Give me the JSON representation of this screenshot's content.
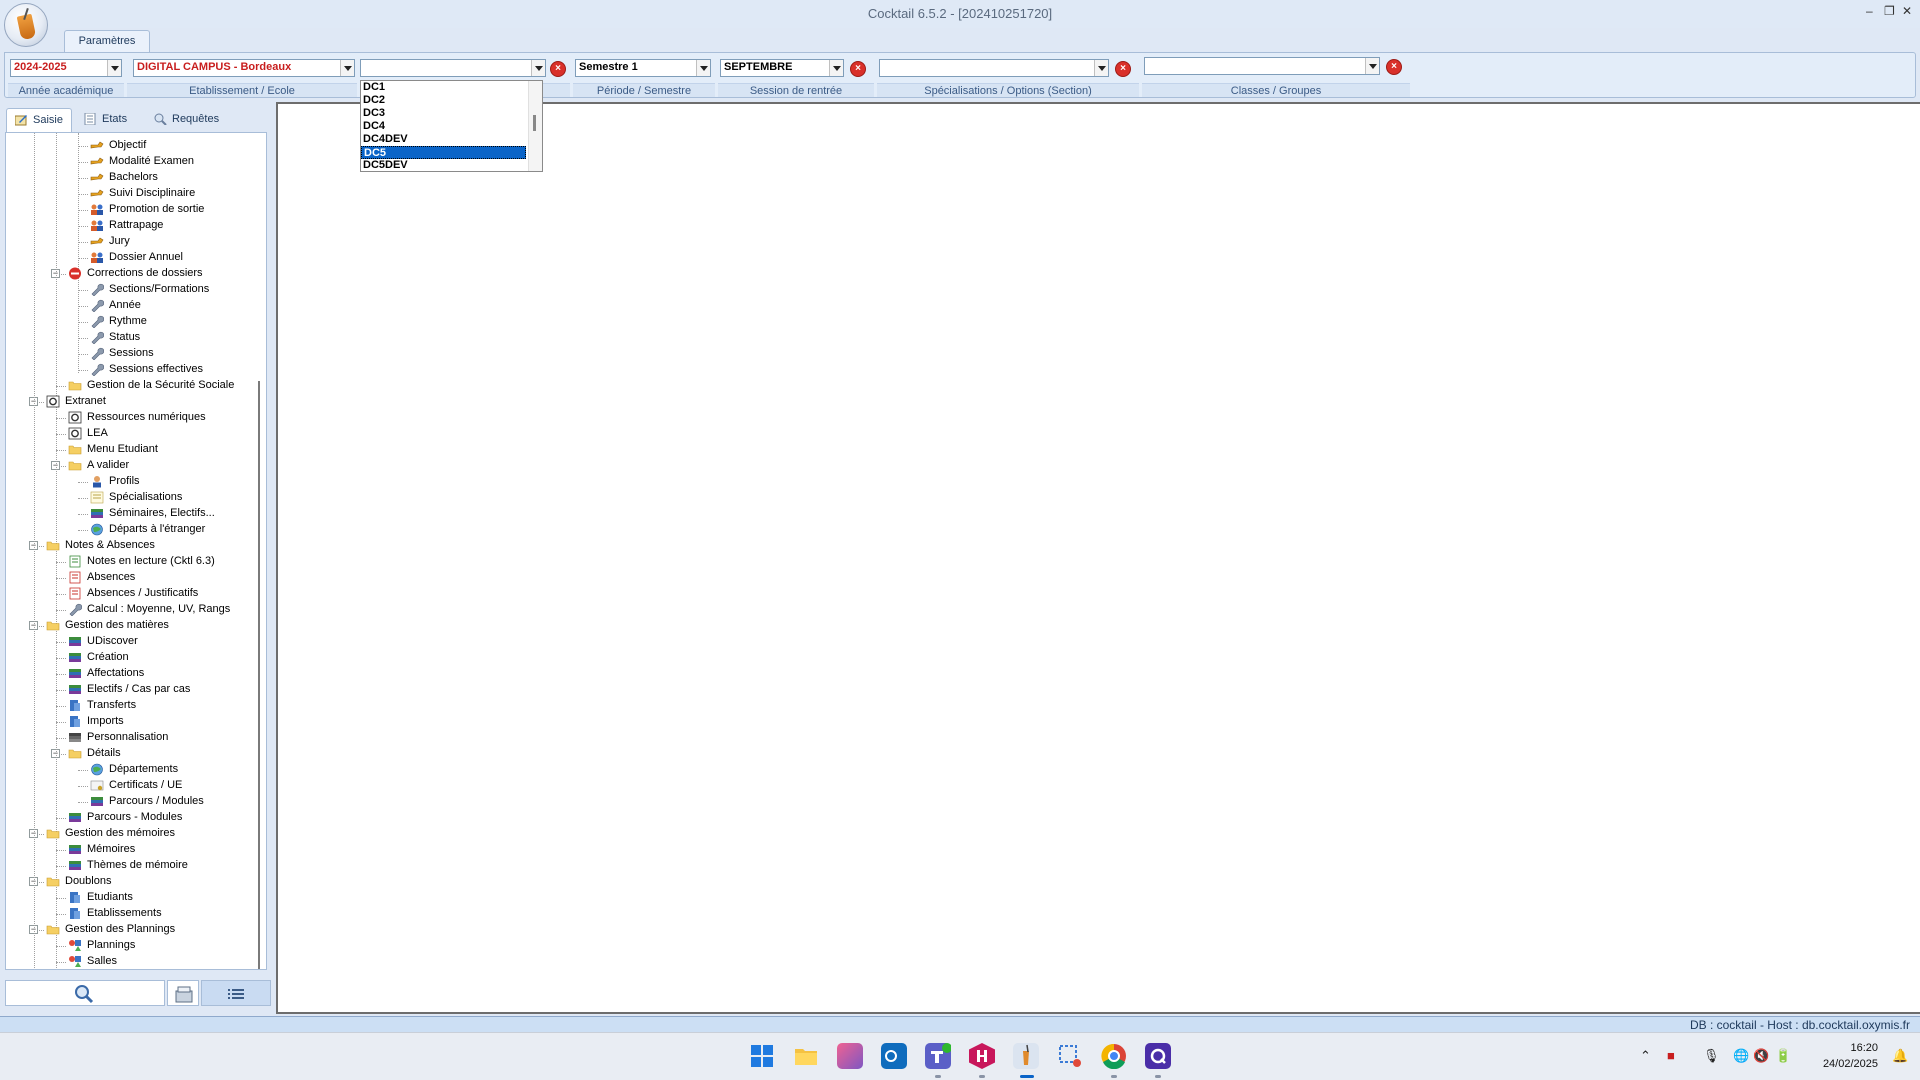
{
  "window": {
    "title": "Cocktail 6.5.2 -   [202410251720]",
    "ribbon_tab": "Paramètres"
  },
  "params": {
    "annee": {
      "value": "2024-2025",
      "label": "Année académique"
    },
    "etablissement": {
      "value": "DIGITAL CAMPUS - Bordeaux",
      "label": "Etablissement / Ecole"
    },
    "section": {
      "value": ""
    },
    "periode": {
      "value": "Semestre 1",
      "label": "Période / Semestre"
    },
    "session": {
      "value": "SEPTEMBRE",
      "label": "Session de rentrée"
    },
    "specialisation": {
      "value": "",
      "label": "Spécialisations / Options (Section)"
    },
    "classes": {
      "value": "",
      "label": "Classes / Groupes"
    }
  },
  "dropdown": {
    "items": [
      "DC1",
      "DC2",
      "DC3",
      "DC4",
      "DC4DEV",
      "DC5",
      "DC5DEV"
    ],
    "selected": "DC5"
  },
  "side_tabs": [
    "Saisie",
    "Etats",
    "Requêtes"
  ],
  "tree": [
    {
      "label": "Objectif"
    },
    {
      "label": "Modalité Examen"
    },
    {
      "label": "Bachelors"
    },
    {
      "label": "Suivi Disciplinaire"
    },
    {
      "label": "Promotion de sortie"
    },
    {
      "label": "Rattrapage"
    },
    {
      "label": "Jury"
    },
    {
      "label": "Dossier Annuel"
    },
    {
      "label": "Corrections de dossiers"
    },
    {
      "label": "Sections/Formations"
    },
    {
      "label": "Année"
    },
    {
      "label": "Rythme"
    },
    {
      "label": "Status"
    },
    {
      "label": "Sessions"
    },
    {
      "label": "Sessions effectives"
    },
    {
      "label": "Gestion de la Sécurité Sociale"
    },
    {
      "label": "Extranet"
    },
    {
      "label": "Ressources numériques"
    },
    {
      "label": "LEA"
    },
    {
      "label": "Menu Etudiant"
    },
    {
      "label": "A valider"
    },
    {
      "label": "Profils"
    },
    {
      "label": "Spécialisations"
    },
    {
      "label": "Séminaires, Electifs..."
    },
    {
      "label": "Départs à l'étranger"
    },
    {
      "label": "Notes & Absences"
    },
    {
      "label": "Notes en lecture (Cktl 6.3)"
    },
    {
      "label": "Absences"
    },
    {
      "label": "Absences / Justificatifs"
    },
    {
      "label": "Calcul : Moyenne, UV, Rangs"
    },
    {
      "label": "Gestion des matières"
    },
    {
      "label": "UDiscover"
    },
    {
      "label": "Création"
    },
    {
      "label": "Affectations"
    },
    {
      "label": "Electifs / Cas par cas"
    },
    {
      "label": "Transferts"
    },
    {
      "label": "Imports"
    },
    {
      "label": "Personnalisation"
    },
    {
      "label": "Détails"
    },
    {
      "label": "Départements"
    },
    {
      "label": "Certificats / UE"
    },
    {
      "label": "Parcours / Modules"
    },
    {
      "label": "Parcours - Modules"
    },
    {
      "label": "Gestion des mémoires"
    },
    {
      "label": "Mémoires"
    },
    {
      "label": "Thèmes de mémoire"
    },
    {
      "label": "Doublons"
    },
    {
      "label": "Etudiants"
    },
    {
      "label": "Etablissements"
    },
    {
      "label": "Gestion des Plannings"
    },
    {
      "label": "Plannings"
    },
    {
      "label": "Salles"
    }
  ],
  "status": {
    "db": "DB : cocktail - Host : db.cocktail.oxymis.fr"
  },
  "clock": {
    "time": "16:20",
    "date": "24/02/2025"
  },
  "colors": {
    "accent": "#0a64c8",
    "etab_text": "#c81e1e",
    "ribbon_bg": "#e3edf9"
  }
}
